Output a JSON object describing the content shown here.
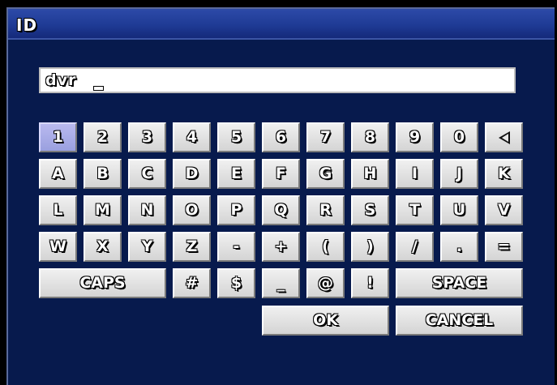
{
  "dialog": {
    "title": "ID"
  },
  "input": {
    "value": "dvr"
  },
  "keyboard": {
    "selected_key": "1",
    "row1": [
      "1",
      "2",
      "3",
      "4",
      "5",
      "6",
      "7",
      "8",
      "9",
      "0"
    ],
    "backspace_icon": "backspace-arrow-icon",
    "row2": [
      "A",
      "B",
      "C",
      "D",
      "E",
      "F",
      "G",
      "H",
      "I",
      "J",
      "K"
    ],
    "row3": [
      "L",
      "M",
      "N",
      "O",
      "P",
      "Q",
      "R",
      "S",
      "T",
      "U",
      "V"
    ],
    "row4": [
      "W",
      "X",
      "Y",
      "Z",
      "-",
      "+",
      "(",
      ")",
      "/",
      ".",
      "="
    ],
    "row5": {
      "caps": "CAPS",
      "symbols": [
        "#",
        "$",
        "_",
        "@",
        "!"
      ],
      "space": "SPACE"
    },
    "row6": {
      "ok": "OK",
      "cancel": "CANCEL"
    }
  }
}
